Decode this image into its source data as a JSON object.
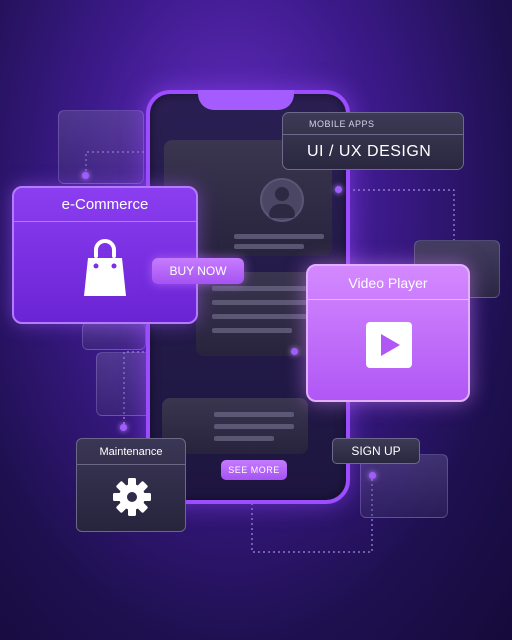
{
  "colors": {
    "accent": "#9b4dff",
    "ecommerce": "#7a31e2",
    "video_player": "#c26ff8",
    "dark_card": "#2f2b48"
  },
  "cards": {
    "ecommerce": {
      "title": "e-Commerce",
      "icon": "shopping-bag-icon"
    },
    "uiux": {
      "subtitle": "MOBILE APPS",
      "title": "UI / UX DESIGN"
    },
    "video_player": {
      "title": "Video Player",
      "icon": "play-icon"
    },
    "maintenance": {
      "title": "Maintenance",
      "icon": "gear-icon"
    }
  },
  "buttons": {
    "buy_now": "BUY NOW",
    "see_more": "SEE MORE",
    "sign_up": "SIGN UP"
  }
}
